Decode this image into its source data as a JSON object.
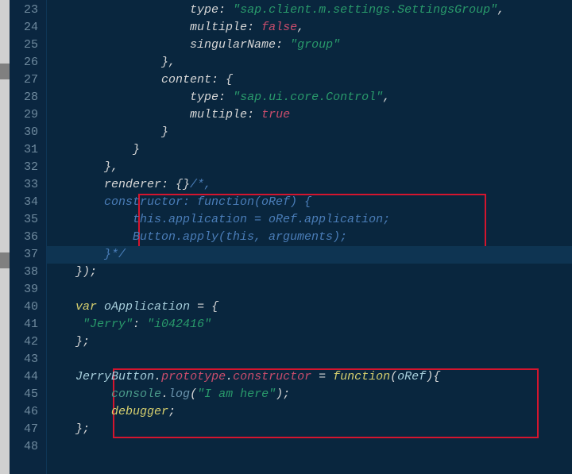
{
  "lines": [
    {
      "n": 23,
      "segs": [
        [
          "pl",
          "                    "
        ],
        [
          "key",
          "type"
        ],
        [
          "pl",
          ": "
        ],
        [
          "str",
          "\"sap.client.m.settings.SettingsGroup\""
        ],
        [
          "pl",
          ","
        ]
      ]
    },
    {
      "n": 24,
      "segs": [
        [
          "pl",
          "                    "
        ],
        [
          "key",
          "multiple"
        ],
        [
          "pl",
          ": "
        ],
        [
          "bool",
          "false"
        ],
        [
          "pl",
          ","
        ]
      ]
    },
    {
      "n": 25,
      "segs": [
        [
          "pl",
          "                    "
        ],
        [
          "key",
          "singularName"
        ],
        [
          "pl",
          ": "
        ],
        [
          "str",
          "\"group\""
        ]
      ]
    },
    {
      "n": 26,
      "segs": [
        [
          "pl",
          "                },"
        ]
      ]
    },
    {
      "n": 27,
      "segs": [
        [
          "pl",
          "                "
        ],
        [
          "key",
          "content"
        ],
        [
          "pl",
          ": {"
        ]
      ]
    },
    {
      "n": 28,
      "segs": [
        [
          "pl",
          "                    "
        ],
        [
          "key",
          "type"
        ],
        [
          "pl",
          ": "
        ],
        [
          "str",
          "\"sap.ui.core.Control\""
        ],
        [
          "pl",
          ","
        ]
      ]
    },
    {
      "n": 29,
      "segs": [
        [
          "pl",
          "                    "
        ],
        [
          "key",
          "multiple"
        ],
        [
          "pl",
          ": "
        ],
        [
          "bool",
          "true"
        ]
      ]
    },
    {
      "n": 30,
      "segs": [
        [
          "pl",
          "                }"
        ]
      ]
    },
    {
      "n": 31,
      "segs": [
        [
          "pl",
          "            }"
        ]
      ]
    },
    {
      "n": 32,
      "segs": [
        [
          "pl",
          "        },"
        ]
      ]
    },
    {
      "n": 33,
      "segs": [
        [
          "pl",
          "        "
        ],
        [
          "key",
          "renderer"
        ],
        [
          "pl",
          ": {}"
        ],
        [
          "cmt",
          "/*,"
        ]
      ]
    },
    {
      "n": 34,
      "segs": [
        [
          "cmt",
          "        constructor: function(oRef) {"
        ]
      ]
    },
    {
      "n": 35,
      "segs": [
        [
          "cmt",
          "            this.application = oRef.application;"
        ]
      ]
    },
    {
      "n": 36,
      "segs": [
        [
          "cmt",
          "            Button.apply(this, arguments);"
        ]
      ]
    },
    {
      "n": 37,
      "segs": [
        [
          "cmt",
          "        }*/"
        ]
      ],
      "current": true
    },
    {
      "n": 38,
      "segs": [
        [
          "pl",
          "    });"
        ]
      ]
    },
    {
      "n": 39,
      "segs": [
        [
          "pl",
          ""
        ]
      ]
    },
    {
      "n": 40,
      "segs": [
        [
          "pl",
          "    "
        ],
        [
          "kw",
          "var"
        ],
        [
          "pl",
          " "
        ],
        [
          "prop",
          "oApplication"
        ],
        [
          "pl",
          " = {"
        ]
      ]
    },
    {
      "n": 41,
      "segs": [
        [
          "pl",
          "     "
        ],
        [
          "str",
          "\"Jerry\""
        ],
        [
          "pl",
          ": "
        ],
        [
          "str",
          "\"i042416\""
        ]
      ]
    },
    {
      "n": 42,
      "segs": [
        [
          "pl",
          "    };"
        ]
      ]
    },
    {
      "n": 43,
      "segs": [
        [
          "pl",
          ""
        ]
      ]
    },
    {
      "n": 44,
      "segs": [
        [
          "pl",
          "    "
        ],
        [
          "prop",
          "JerryButton"
        ],
        [
          "pl",
          "."
        ],
        [
          "reddish",
          "prototype"
        ],
        [
          "pl",
          "."
        ],
        [
          "reddish",
          "constructor"
        ],
        [
          "pl",
          " = "
        ],
        [
          "kw",
          "function"
        ],
        [
          "pl",
          "("
        ],
        [
          "prop",
          "oRef"
        ],
        [
          "pl",
          "){"
        ]
      ]
    },
    {
      "n": 45,
      "segs": [
        [
          "pl",
          "         "
        ],
        [
          "glob",
          "console"
        ],
        [
          "pl",
          "."
        ],
        [
          "func",
          "log"
        ],
        [
          "pl",
          "("
        ],
        [
          "str",
          "\"I am here\""
        ],
        [
          "pl",
          ");"
        ]
      ]
    },
    {
      "n": 46,
      "segs": [
        [
          "pl",
          "         "
        ],
        [
          "kw",
          "debugger"
        ],
        [
          "pl",
          ";"
        ]
      ]
    },
    {
      "n": 47,
      "segs": [
        [
          "pl",
          "    };"
        ]
      ]
    },
    {
      "n": 48,
      "segs": [
        [
          "pl",
          ""
        ]
      ]
    }
  ]
}
